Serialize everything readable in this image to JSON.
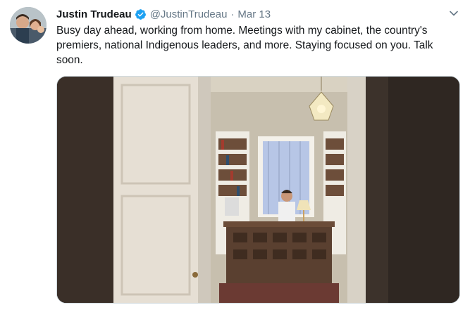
{
  "tweet": {
    "author_name": "Justin Trudeau",
    "handle": "@JustinTrudeau",
    "separator": "·",
    "date": "Mar 13",
    "text": "Busy day ahead, working from home. Meetings with my cabinet, the country's premiers, national Indigenous leaders, and more. Staying focused on you. Talk soon."
  },
  "icons": {
    "verified": "verified-badge-icon",
    "more": "chevron-down-icon"
  },
  "colors": {
    "verified": "#1da1f2",
    "secondary_text": "#657786",
    "primary_text": "#14171a"
  }
}
